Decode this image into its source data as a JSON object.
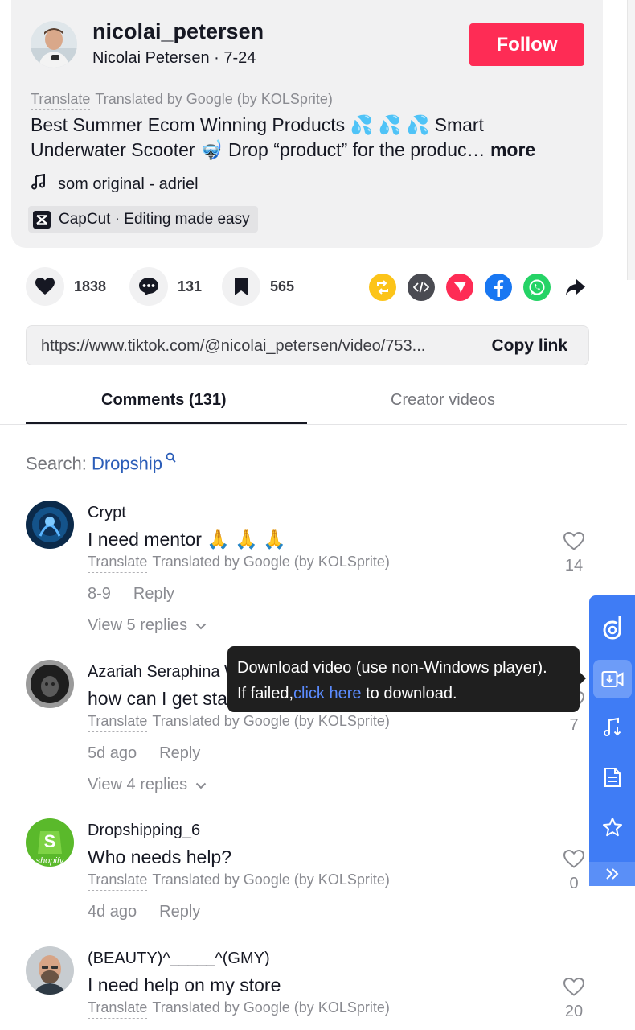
{
  "post": {
    "username": "nicolai_petersen",
    "nickname_line": "Nicolai Petersen · 7-24",
    "follow_label": "Follow",
    "translate_link": "Translate",
    "translated_by": "Translated by Google (by KOLSprite)",
    "caption_line1": "Best Summer Ecom Winning Products 💦 💦 💦 Smart",
    "caption_line2": "Underwater Scooter 🤿 Drop “product” for the produc…",
    "more_label": "more",
    "music": "som original - adriel",
    "capcut": "CapCut · Editing made easy"
  },
  "actions": {
    "likes": "1838",
    "comments": "131",
    "saves": "565",
    "share_icons": [
      "repost-icon",
      "embed-icon",
      "send-icon",
      "facebook-icon",
      "whatsapp-icon",
      "share-arrow-icon"
    ]
  },
  "link_bar": {
    "url": "https://www.tiktok.com/@nicolai_petersen/video/753...",
    "copy_label": "Copy link"
  },
  "tabs": {
    "comments": "Comments (131)",
    "creator": "Creator videos"
  },
  "search": {
    "label": "Search: ",
    "keyword": "Dropship"
  },
  "comments": [
    {
      "user": "Crypt",
      "text": "I need mentor 🙏 🙏 🙏",
      "translate": "Translate",
      "translated_by": "Translated by Google (by KOLSprite)",
      "date": "8-9",
      "reply": "Reply",
      "view_replies": "View 5 replies",
      "likes": "14"
    },
    {
      "user": "Azariah Seraphina W",
      "text": "how can I get started",
      "translate": "Translate",
      "translated_by": "Translated by Google (by KOLSprite)",
      "date": "5d ago",
      "reply": "Reply",
      "view_replies": "View 4 replies",
      "likes": "7"
    },
    {
      "user": "Dropshipping_6",
      "text": "Who needs help?",
      "translate": "Translate",
      "translated_by": "Translated by Google (by KOLSprite)",
      "date": "4d ago",
      "reply": "Reply",
      "likes": "0"
    },
    {
      "user": "(BEAUTY)^_____^(GMY)",
      "text": "I need help on my store",
      "translate": "Translate",
      "translated_by": "Translated by Google (by KOLSprite)",
      "likes": "20"
    }
  ],
  "tooltip": {
    "line1": "Download video (use non-Windows player).",
    "line2_prefix": "If failed,",
    "link": "click here",
    "line2_suffix": " to download."
  },
  "side_panel": {
    "icons": [
      "logo-icon",
      "download-video-icon",
      "music-download-icon",
      "document-icon",
      "star-icon",
      "collapse-icon"
    ]
  },
  "colors": {
    "follow": "#fe2c55",
    "link": "#2b5db8",
    "side_panel": "#3f7cf5"
  }
}
